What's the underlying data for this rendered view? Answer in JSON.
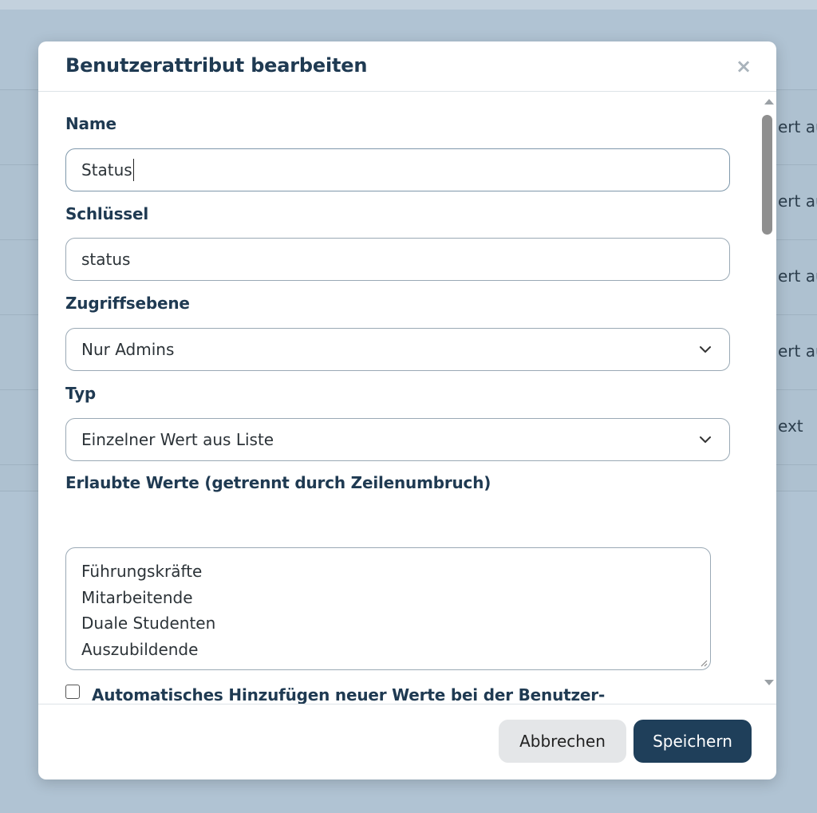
{
  "background": {
    "row_snippets": [
      "ert au",
      "ert au",
      "ert au",
      "ert au",
      "ext"
    ]
  },
  "modal": {
    "title": "Benutzerattribut bearbeiten",
    "close_icon": "×",
    "fields": {
      "name": {
        "label": "Name",
        "value": "Status"
      },
      "key": {
        "label": "Schlüssel",
        "value": "status"
      },
      "access_level": {
        "label": "Zugriffsebene",
        "value": "Nur Admins"
      },
      "type": {
        "label": "Typ",
        "value": "Einzelner Wert aus Liste"
      },
      "allowed_values": {
        "label": "Erlaubte Werte (getrennt durch Zeilenumbruch)",
        "lines": [
          "Führungskräfte",
          "Mitarbeitende",
          "Duale Studenten",
          "Auszubildende"
        ]
      },
      "auto_add": {
        "label": "Automatisches Hinzufügen neuer Werte bei der Benutzer-Synchronisation",
        "checked": false
      }
    },
    "buttons": {
      "cancel": "Abbrechen",
      "save": "Speichern"
    }
  },
  "colors": {
    "primary": "#1f3f5a",
    "label_text": "#1f3a52",
    "overlay": "#b0c3d3"
  },
  "icons": [
    "close-icon",
    "chevron-down-icon",
    "scroll-up-arrow-icon",
    "scroll-down-arrow-icon",
    "resize-grip-icon"
  ]
}
